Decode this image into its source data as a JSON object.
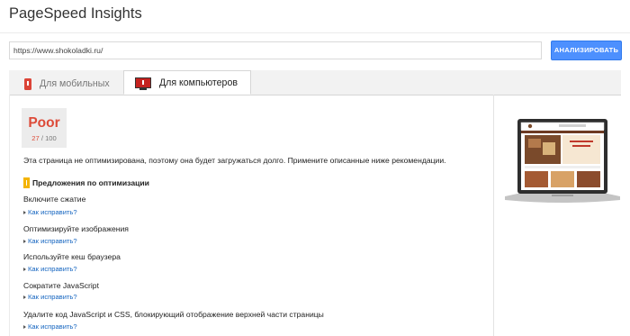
{
  "app": {
    "title": "PageSpeed Insights"
  },
  "search": {
    "url_value": "https://www.shokoladki.ru/",
    "analyze_label": "АНАЛИЗИРОВАТЬ"
  },
  "tabs": [
    {
      "label": "Для мобильных",
      "icon": "phone-icon",
      "active": false
    },
    {
      "label": "Для компьютеров",
      "icon": "monitor-icon",
      "active": true
    }
  ],
  "score": {
    "label": "Poor",
    "value": "27",
    "max": "/ 100",
    "color": "#dd4b39"
  },
  "summary": "Эта страница не оптимизирована, поэтому она будет загружаться долго. Примените описанные ниже рекомендации.",
  "suggestions": {
    "title": "Предложения по оптимизации",
    "icon": "warning-icon",
    "items": [
      {
        "title": "Включите сжатие",
        "link": "Как исправить?"
      },
      {
        "title": "Оптимизируйте изображения",
        "link": "Как исправить?"
      },
      {
        "title": "Используйте кеш браузера",
        "link": "Как исправить?"
      },
      {
        "title": "Сократите JavaScript",
        "link": "Как исправить?"
      },
      {
        "title": "Удалите код JavaScript и CSS, блокирующий отображение верхней части страницы",
        "link": "Как исправить?"
      }
    ]
  },
  "colors": {
    "accent": "#4d90fe",
    "poor": "#dd4b39",
    "warning": "#f4b400",
    "link": "#1565c0"
  }
}
